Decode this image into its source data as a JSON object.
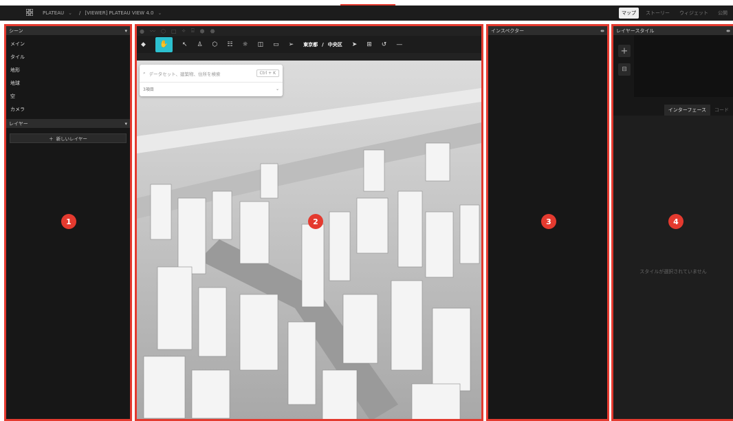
{
  "topbar": {
    "project": "PLATEAU",
    "separator": "/",
    "viewer": "[VIEWER] PLATEAU VIEW 4.0",
    "tabs": [
      "マップ",
      "ストーリー",
      "ウィジェット",
      "公開"
    ]
  },
  "scene_panel": {
    "title": "シーン",
    "items": [
      "メイン",
      "タイル",
      "地形",
      "地球",
      "空",
      "カメラ"
    ],
    "layer_title": "レイヤー",
    "new_layer": "新しいレイヤー",
    "badge": "1"
  },
  "map_panel": {
    "search_placeholder": "データセット、建築物、住所を検索",
    "search_shortcut": "Ctrl + K",
    "item_count": "3項目",
    "prefecture": "東京都",
    "location_sep": "/",
    "ward": "中央区",
    "badge": "2"
  },
  "inspector_panel": {
    "title": "インスペクター",
    "badge": "3"
  },
  "layer_style_panel": {
    "title": "レイヤースタイル",
    "tabs": [
      "インターフェース",
      "コード"
    ],
    "empty_message": "スタイルが選択されていません",
    "badge": "4"
  },
  "colors": {
    "accent_red": "#e43a2f",
    "active_tool": "#2cc0cf",
    "panel_bg": "#171717"
  }
}
